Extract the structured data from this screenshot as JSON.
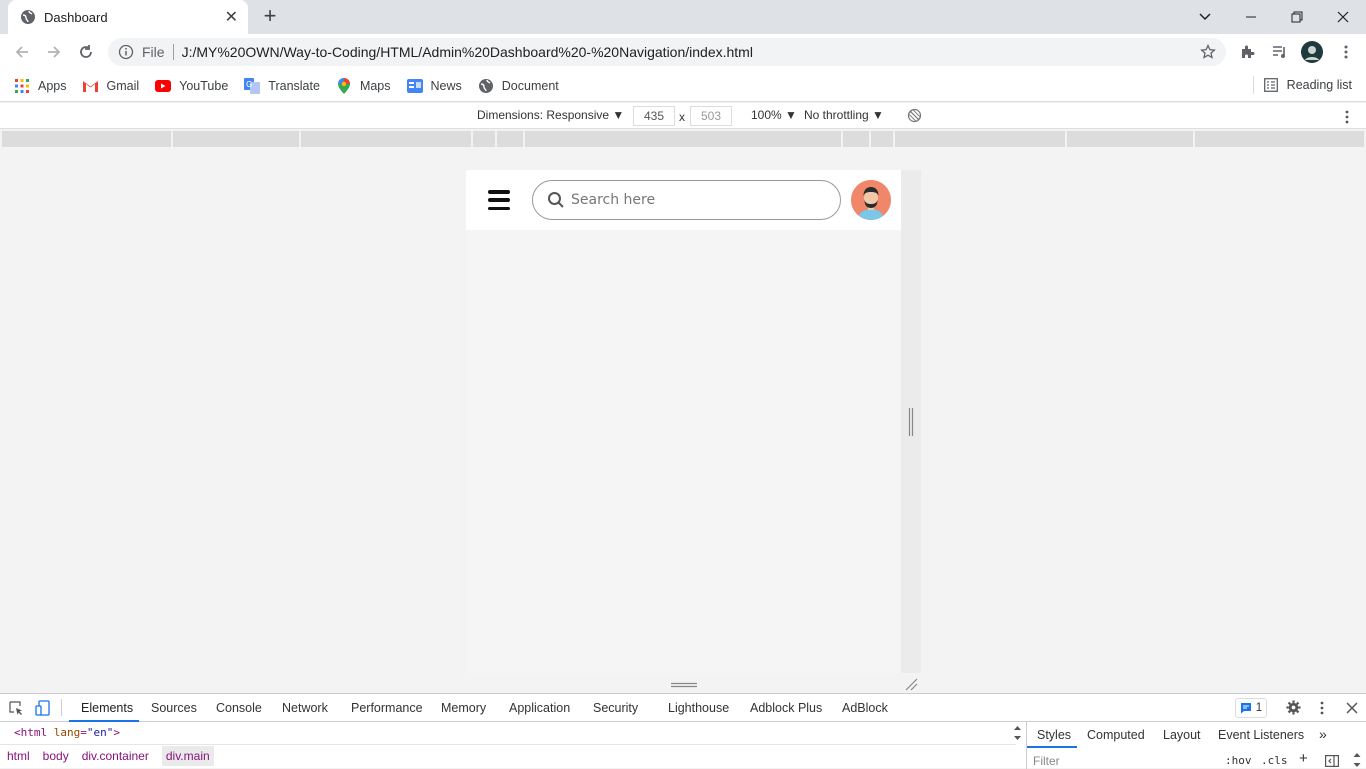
{
  "browser": {
    "tab_title": "Dashboard",
    "new_tab_symbol": "+",
    "close_tab_symbol": "✕",
    "omnibox_scheme": "File",
    "url": "J:/MY%20OWN/Way-to-Coding/HTML/Admin%20Dashboard%20-%20Navigation/index.html"
  },
  "bookmarks": {
    "items": [
      "Apps",
      "Gmail",
      "YouTube",
      "Translate",
      "Maps",
      "News",
      "Document"
    ],
    "reading_list": "Reading list"
  },
  "device_toolbar": {
    "dimensions_label": "Dimensions: Responsive",
    "width": "435",
    "height": "503",
    "times": "x",
    "zoom": "100%",
    "throttling": "No throttling"
  },
  "page": {
    "search_placeholder": "Search here"
  },
  "devtools": {
    "tabs": [
      "Elements",
      "Sources",
      "Console",
      "Network",
      "Performance",
      "Memory",
      "Application",
      "Security",
      "Lighthouse",
      "Adblock Plus",
      "AdBlock"
    ],
    "issues_count": "1",
    "code_tag": "html",
    "code_attr": "lang",
    "code_val": "\"en\"",
    "breadcrumbs": [
      "html",
      "body",
      "div.container",
      "div.main"
    ],
    "side_tabs": [
      "Styles",
      "Computed",
      "Layout",
      "Event Listeners"
    ],
    "filter_placeholder": "Filter",
    "hov": ":hov",
    "cls": ".cls"
  },
  "colors": {
    "accent": "#1a73e8",
    "avatar_bg": "#f0876a"
  }
}
